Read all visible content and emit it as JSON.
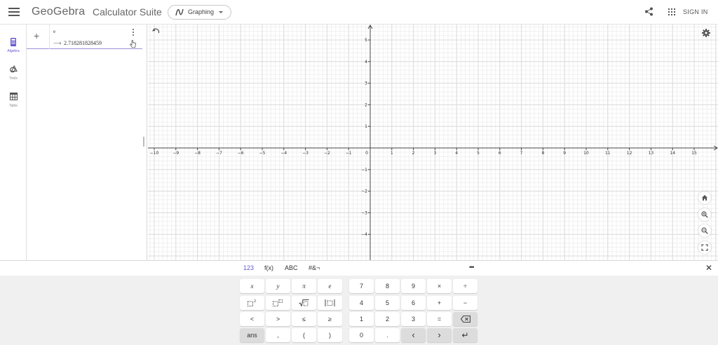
{
  "header": {
    "logo": "GeoGebra",
    "suite_title": "Calculator Suite",
    "app_picker_label": "Graphing",
    "signin_label": "SIGN IN",
    "icons": [
      "menu-icon",
      "graphing-icon",
      "chevron-down-icon",
      "share-icon",
      "apps-grid-icon"
    ]
  },
  "rail": {
    "items": [
      {
        "label": "Algebra",
        "icon": "calculator-icon",
        "active": true
      },
      {
        "label": "Tools",
        "icon": "tools-icon",
        "active": false
      },
      {
        "label": "Table",
        "icon": "table-icon",
        "active": false
      }
    ]
  },
  "algebra": {
    "add_label": "+",
    "rows": [
      {
        "input": "e",
        "arrow": "⟶",
        "output": "2.718281828459"
      }
    ]
  },
  "graphics": {
    "x_ticks": [
      "−10",
      "−9",
      "−8",
      "−7",
      "−6",
      "−5",
      "−4",
      "−3",
      "−2",
      "−1",
      "0",
      "1",
      "2",
      "3",
      "4",
      "5",
      "6",
      "7",
      "8",
      "9",
      "10",
      "11",
      "12",
      "13",
      "14",
      "15"
    ],
    "y_ticks_pos": [
      "5",
      "4",
      "3",
      "2",
      "1"
    ],
    "y_ticks_neg": [
      "−1",
      "−2",
      "−3",
      "−4"
    ],
    "x_range": [
      -10,
      15
    ],
    "y_range": [
      -4,
      5
    ],
    "grid": true,
    "icons": [
      "undo-icon",
      "settings-gear-icon",
      "home-icon",
      "zoom-in-icon",
      "zoom-out-icon",
      "fullscreen-icon"
    ]
  },
  "keyboard": {
    "tabs": [
      {
        "label": "123",
        "active": true
      },
      {
        "label": "f(x)",
        "active": false
      },
      {
        "label": "ABC",
        "active": false
      },
      {
        "label": "#&¬",
        "active": false
      }
    ],
    "more_label": "•••",
    "close_label": "✕",
    "left_rows": [
      [
        "x",
        "y",
        "π",
        "e"
      ],
      [
        "x²",
        "xⁿ",
        "√",
        "|x|"
      ],
      [
        "<",
        ">",
        "≤",
        "≥"
      ],
      [
        "ans",
        ",",
        "(",
        ")"
      ]
    ],
    "right_rows": [
      [
        "7",
        "8",
        "9",
        "×",
        "÷"
      ],
      [
        "4",
        "5",
        "6",
        "+",
        "−"
      ],
      [
        "1",
        "2",
        "3",
        "=",
        "⌫"
      ],
      [
        "0",
        ".",
        "‹",
        "›",
        "↵"
      ]
    ]
  },
  "colors": {
    "accent": "#6557d2",
    "axis": "#444444",
    "grid_major": "#dcdcdc",
    "grid_minor": "#f0f0f0"
  }
}
